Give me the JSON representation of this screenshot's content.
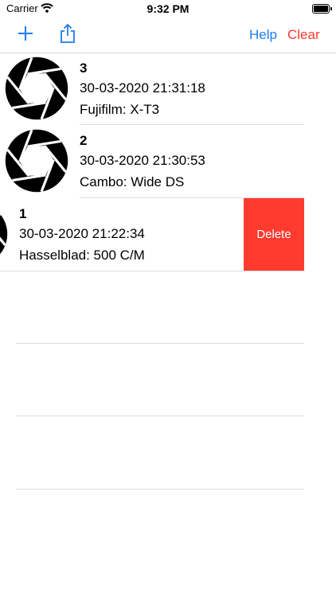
{
  "status": {
    "carrier": "Carrier",
    "time": "9:32 PM"
  },
  "toolbar": {
    "help_label": "Help",
    "clear_label": "Clear",
    "add_icon": "plus-icon",
    "share_icon": "share-icon"
  },
  "colors": {
    "accent": "#1e7cf1",
    "destructive": "#ff3b30"
  },
  "list": {
    "items": [
      {
        "title": "3",
        "date": "30-03-2020 21:31:18",
        "camera": "Fujifilm: X-T3",
        "icon": "aperture-icon"
      },
      {
        "title": "2",
        "date": "30-03-2020 21:30:53",
        "camera": "Cambo: Wide DS",
        "icon": "aperture-icon"
      },
      {
        "title": "1",
        "date": "30-03-2020 21:22:34",
        "camera": "Hasselblad: 500 C/M",
        "icon": "aperture-icon",
        "delete_label": "Delete"
      }
    ]
  }
}
